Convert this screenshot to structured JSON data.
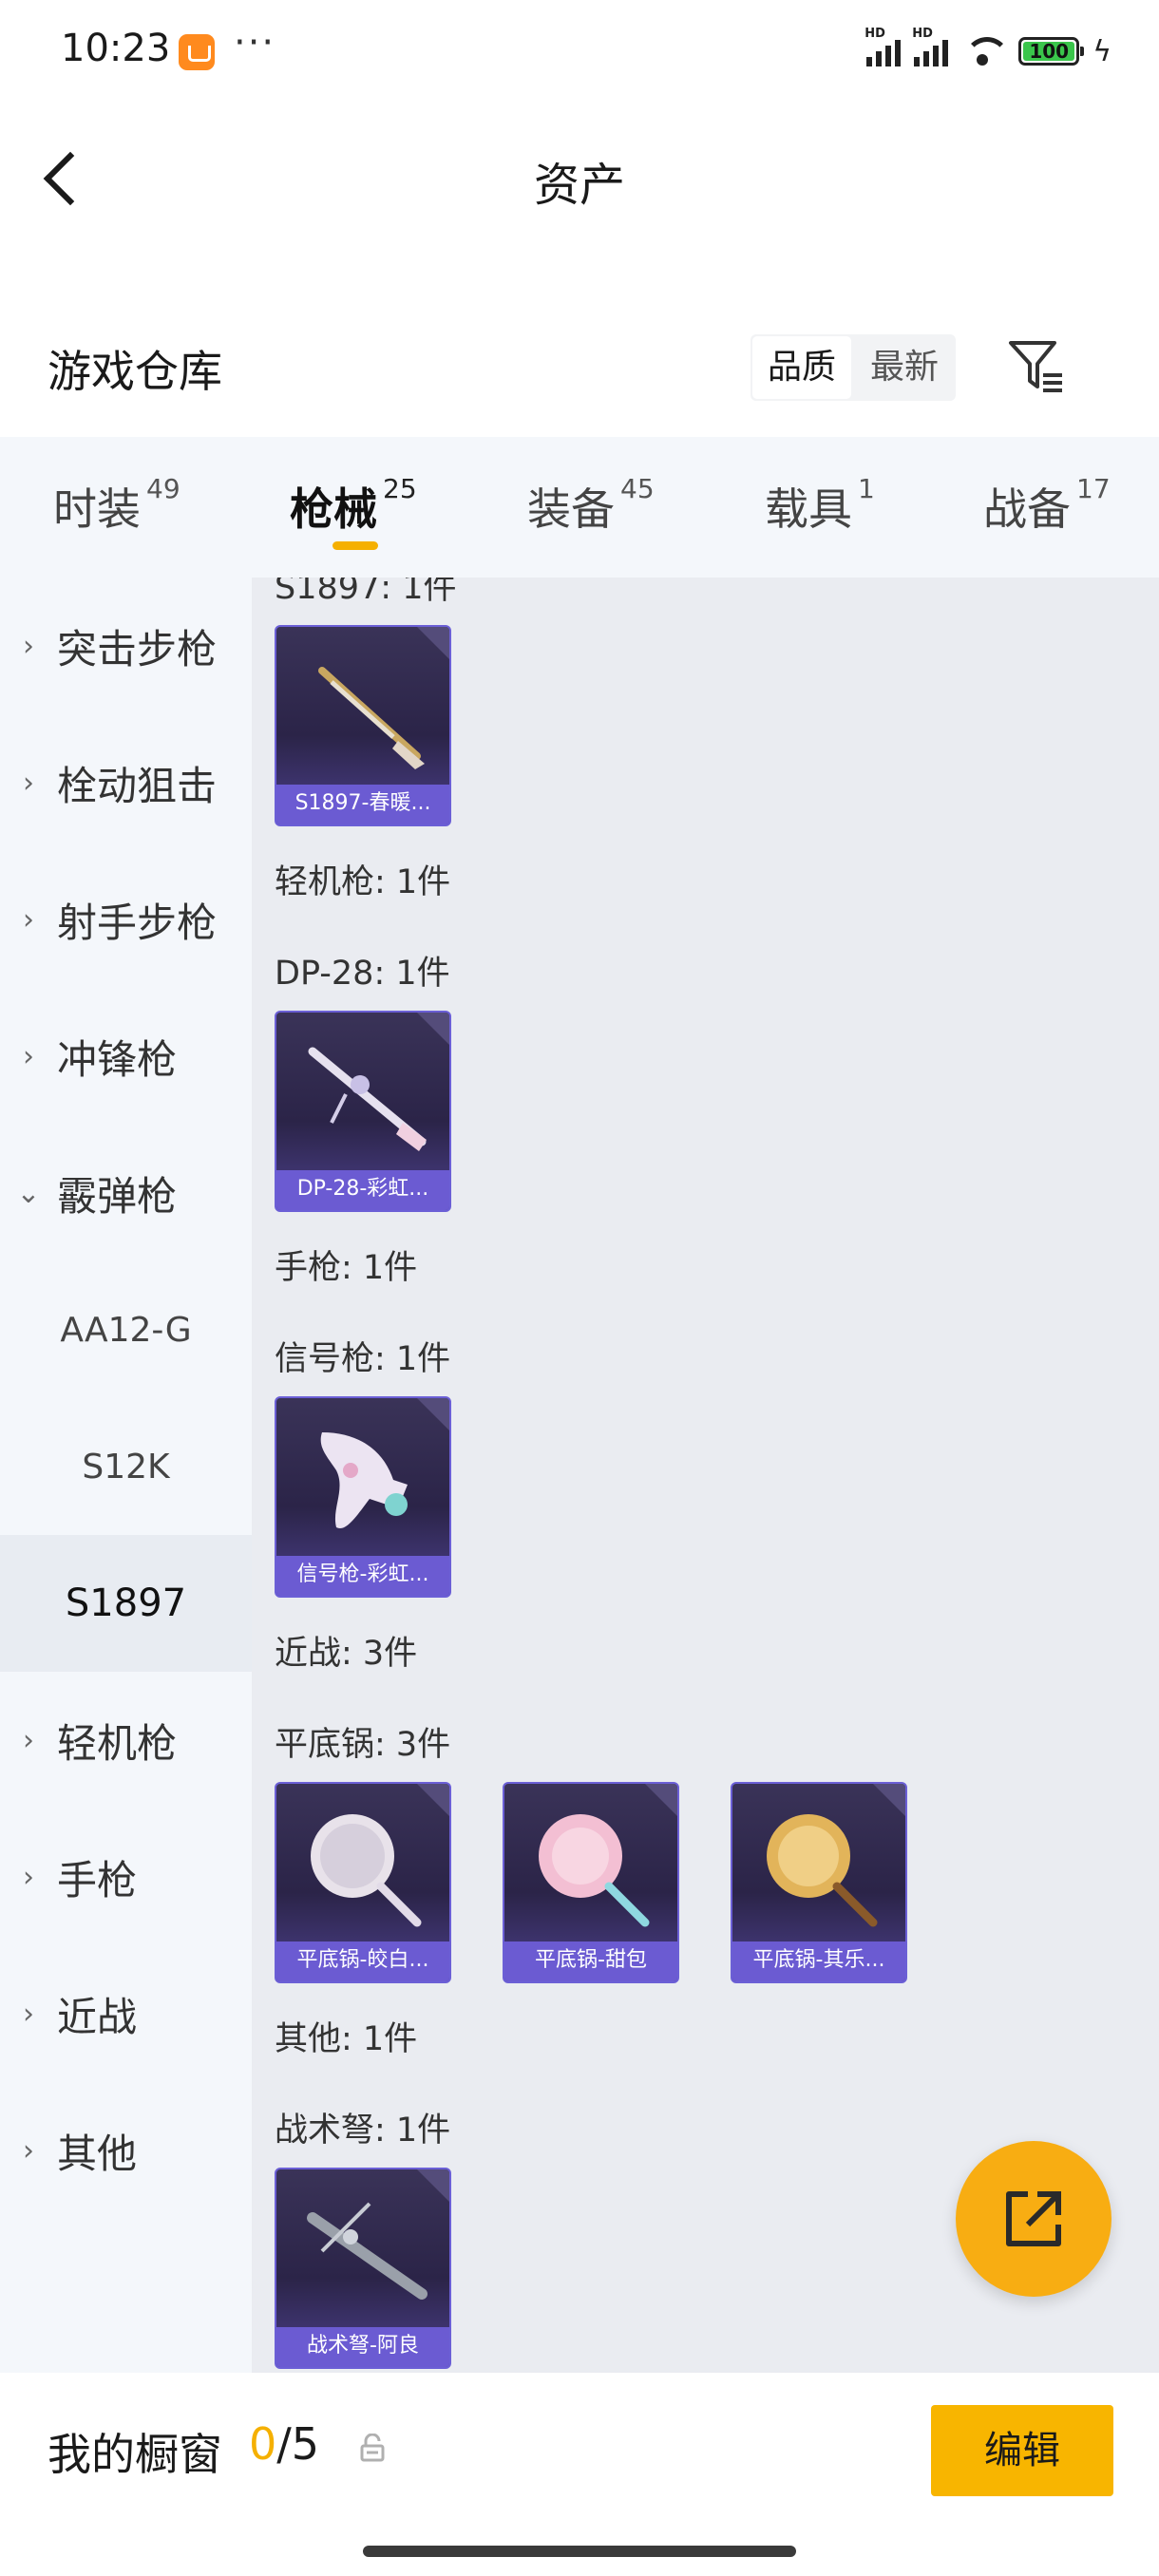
{
  "status": {
    "time": "10:23",
    "more": "···",
    "battery": "100",
    "hd": "HD"
  },
  "header": {
    "title": "资产"
  },
  "warehouse": {
    "title": "游戏仓库",
    "sort_quality": "品质",
    "sort_newest": "最新"
  },
  "tabs": [
    {
      "label": "时装",
      "count": "49"
    },
    {
      "label": "枪械",
      "count": "25",
      "active": true
    },
    {
      "label": "装备",
      "count": "45"
    },
    {
      "label": "载具",
      "count": "1"
    },
    {
      "label": "战备",
      "count": "17"
    }
  ],
  "sidebar": {
    "items": [
      "突击步枪",
      "栓动狙击",
      "射手步枪",
      "冲锋枪",
      "霰弹枪"
    ],
    "sub_items": [
      "AA12-G",
      "S12K",
      "S1897"
    ],
    "items_after": [
      "轻机枪",
      "手枪",
      "近战",
      "其他"
    ]
  },
  "content": {
    "top_label": "S1897: 1件",
    "s1897_card": "S1897-春暖...",
    "lmg_label": "轻机枪: 1件",
    "dp28_label": "DP-28: 1件",
    "dp28_card": "DP-28-彩虹...",
    "pistol_label": "手枪: 1件",
    "flare_label": "信号枪: 1件",
    "flare_card": "信号枪-彩虹...",
    "melee_label": "近战: 3件",
    "pan_label": "平底锅: 3件",
    "pan_cards": [
      "平底锅-皎白...",
      "平底锅-甜包",
      "平底锅-其乐..."
    ],
    "other_label": "其他: 1件",
    "crossbow_label": "战术弩: 1件",
    "crossbow_card": "战术弩-阿良"
  },
  "bottom": {
    "label": "我的橱窗",
    "current": "0",
    "total": "/5",
    "edit": "编辑"
  },
  "colors": {
    "accent": "#f5b000",
    "card_purple": "#6b5bd2",
    "fab": "#f8ad12"
  }
}
